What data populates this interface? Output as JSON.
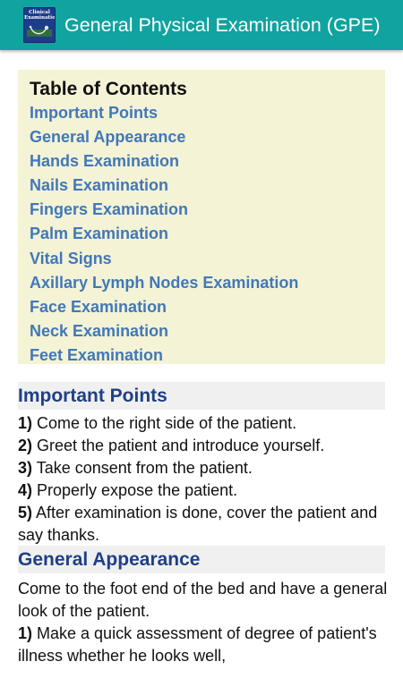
{
  "app_bar": {
    "icon_name": "clinical-examination-app-icon",
    "icon_text": "Clinical Examination",
    "title": "General Physical Examination (GPE)",
    "background": "#10a3a0"
  },
  "toc": {
    "title": "Table of Contents",
    "items": [
      "Important Points",
      "General Appearance",
      "Hands Examination",
      "Nails Examination",
      "Fingers Examination",
      "Palm Examination",
      "Vital Signs",
      "Axillary Lymph Nodes Examination",
      "Face Examination",
      "Neck Examination",
      "Feet Examination"
    ]
  },
  "important_points": {
    "heading": "Important Points",
    "items": [
      {
        "num": "1)",
        "text": " Come to the right side of the patient."
      },
      {
        "num": "2)",
        "text": " Greet the patient and introduce yourself."
      },
      {
        "num": "3)",
        "text": " Take consent from the patient."
      },
      {
        "num": "4)",
        "text": " Properly expose the patient."
      },
      {
        "num": "5)",
        "text": " After examination is done, cover the patient and say thanks."
      }
    ]
  },
  "general_appearance": {
    "heading": "General Appearance",
    "intro": "Come to the foot end of the bed and have a general look of the patient.",
    "items": [
      {
        "num": "1)",
        "text": " Make a quick assessment of degree of patient's illness whether he looks well,"
      }
    ]
  },
  "colors": {
    "link": "#4178b8",
    "heading": "#1f3f87",
    "toc_background": "#f4f3d6",
    "section_background": "#f0f0f0"
  }
}
